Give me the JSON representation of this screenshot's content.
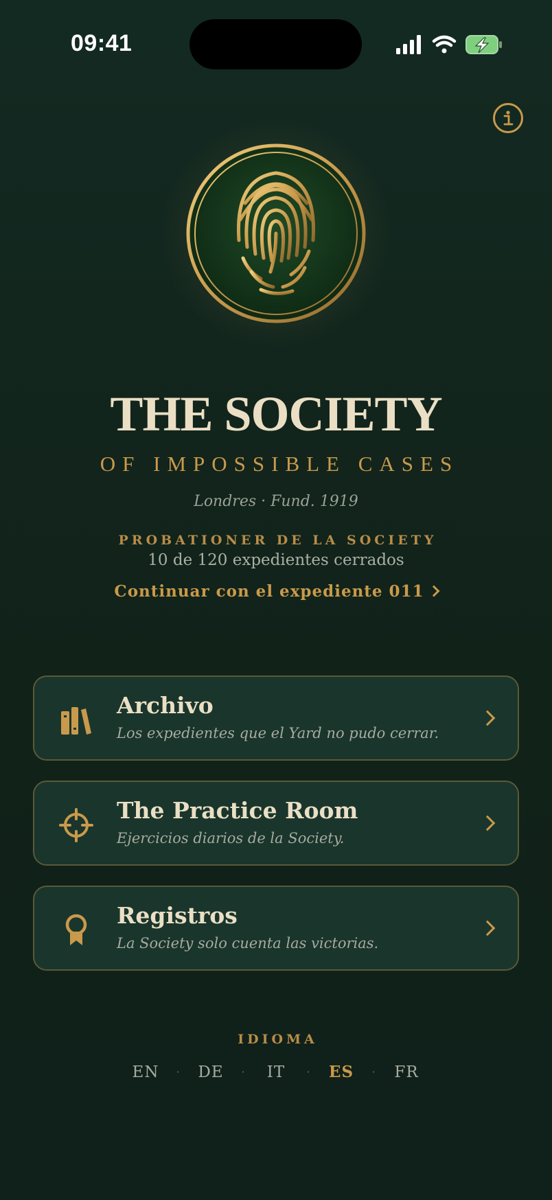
{
  "status_bar": {
    "time": "09:41"
  },
  "header": {
    "title": "THE SOCIETY",
    "subtitle": "OF IMPOSSIBLE CASES",
    "founded": "Londres · Fund. 1919"
  },
  "progress": {
    "rank": "PROBATIONER DE LA SOCIETY",
    "cases_text": "10 de 120 expedientes cerrados",
    "cases_closed": 10,
    "cases_total": 120,
    "continue_label": "Continuar con el expediente 011"
  },
  "menu": [
    {
      "title": "Archivo",
      "desc": "Los expedientes que el Yard no pudo cerrar.",
      "icon": "books-icon"
    },
    {
      "title": "The Practice Room",
      "desc": "Ejercicios diarios de la Society.",
      "icon": "crosshair-icon"
    },
    {
      "title": "Registros",
      "desc": "La Society solo cuenta las victorias.",
      "icon": "award-ribbon-icon"
    }
  ],
  "language": {
    "label": "IDIOMA",
    "options": [
      "EN",
      "DE",
      "IT",
      "ES",
      "FR"
    ],
    "selected": "ES"
  },
  "colors": {
    "background": "#112219",
    "accent_gold": "#c99a4b",
    "text_cream": "#eadfc4",
    "card_bg": "#1a352c",
    "card_border": "#5a5a38"
  }
}
